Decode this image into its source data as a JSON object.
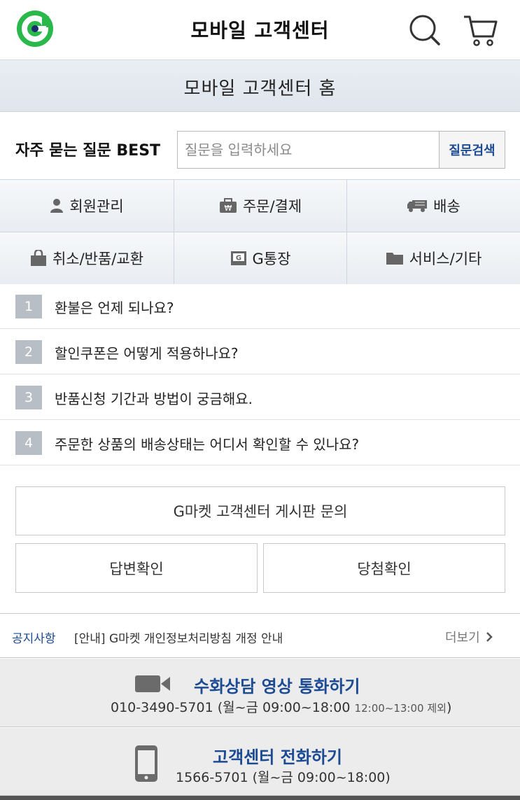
{
  "header": {
    "title": "모바일 고객센터",
    "brand_color": "#2bb84a"
  },
  "subheader": {
    "title": "모바일 고객센터 홈"
  },
  "faq_search": {
    "label": "자주 묻는 질문 BEST",
    "placeholder": "질문을 입력하세요",
    "button": "질문검색"
  },
  "categories": [
    {
      "label": "회원관리",
      "icon": "person-icon"
    },
    {
      "label": "주문/결제",
      "icon": "wallet-icon"
    },
    {
      "label": "배송",
      "icon": "truck-icon"
    },
    {
      "label": "취소/반품/교환",
      "icon": "bag-icon"
    },
    {
      "label": "G통장",
      "icon": "g-bankbook-icon"
    },
    {
      "label": "서비스/기타",
      "icon": "folder-icon"
    }
  ],
  "faq_list": [
    {
      "num": "1",
      "text": "환불은 언제 되나요?"
    },
    {
      "num": "2",
      "text": "할인쿠폰은 어떻게 적용하나요?"
    },
    {
      "num": "3",
      "text": "반품신청 기간과 방법이 궁금해요."
    },
    {
      "num": "4",
      "text": "주문한 상품의 배송상태는 어디서 확인할 수 있나요?"
    }
  ],
  "board": {
    "inquiry": "G마켓 고객센터 게시판 문의",
    "answer_check": "답변확인",
    "winner_check": "당첨확인"
  },
  "notice": {
    "label": "공지사항",
    "text": "[안내] G마켓 개인정보처리방침 개정 안내",
    "more": "더보기"
  },
  "sign_call": {
    "title": "수화상담 영상 통화하기",
    "phone": "010-3490-5701 (월~금 09:00~18:00",
    "note": "12:00~13:00 제외",
    "close": ")"
  },
  "phone_call": {
    "title": "고객센터 전화하기",
    "phone": "1566-5701 (월~금 09:00~18:00)"
  }
}
